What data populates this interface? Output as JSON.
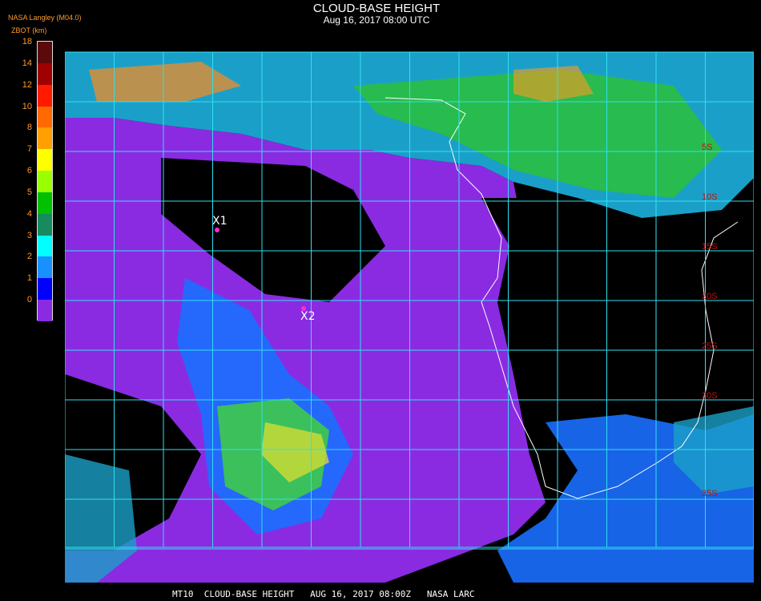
{
  "header": {
    "title": "CLOUD-BASE HEIGHT",
    "datetime": "Aug 16, 2017 08:00 UTC",
    "source": "NASA Langley (M04.0)",
    "parameter": "ZBOT (km)"
  },
  "legend": {
    "levels": [
      {
        "label": "18",
        "color": "#5a0a0a"
      },
      {
        "label": "14",
        "color": "#a00000"
      },
      {
        "label": "12",
        "color": "#ff1a00"
      },
      {
        "label": "10",
        "color": "#ff6a00"
      },
      {
        "label": "8",
        "color": "#ffa000"
      },
      {
        "label": "7",
        "color": "#ffff00"
      },
      {
        "label": "6",
        "color": "#9aff00"
      },
      {
        "label": "5",
        "color": "#00c000"
      },
      {
        "label": "4",
        "color": "#188a60"
      },
      {
        "label": "3",
        "color": "#00ffff"
      },
      {
        "label": "2",
        "color": "#1a90ff"
      },
      {
        "label": "1",
        "color": "#0000ff"
      },
      {
        "label": "0",
        "color": "#8a2be2"
      }
    ]
  },
  "map": {
    "lat_labels": [
      "5S",
      "10S",
      "15S",
      "20S",
      "25S",
      "30S",
      "35S"
    ],
    "lat_label_color": "#c01010",
    "grid_color": "#30e0f0"
  },
  "markers": [
    {
      "label": "X1"
    },
    {
      "label": "X2"
    }
  ],
  "footer": "MT10  CLOUD-BASE HEIGHT   AUG 16, 2017 08:00Z   NASA LARC"
}
